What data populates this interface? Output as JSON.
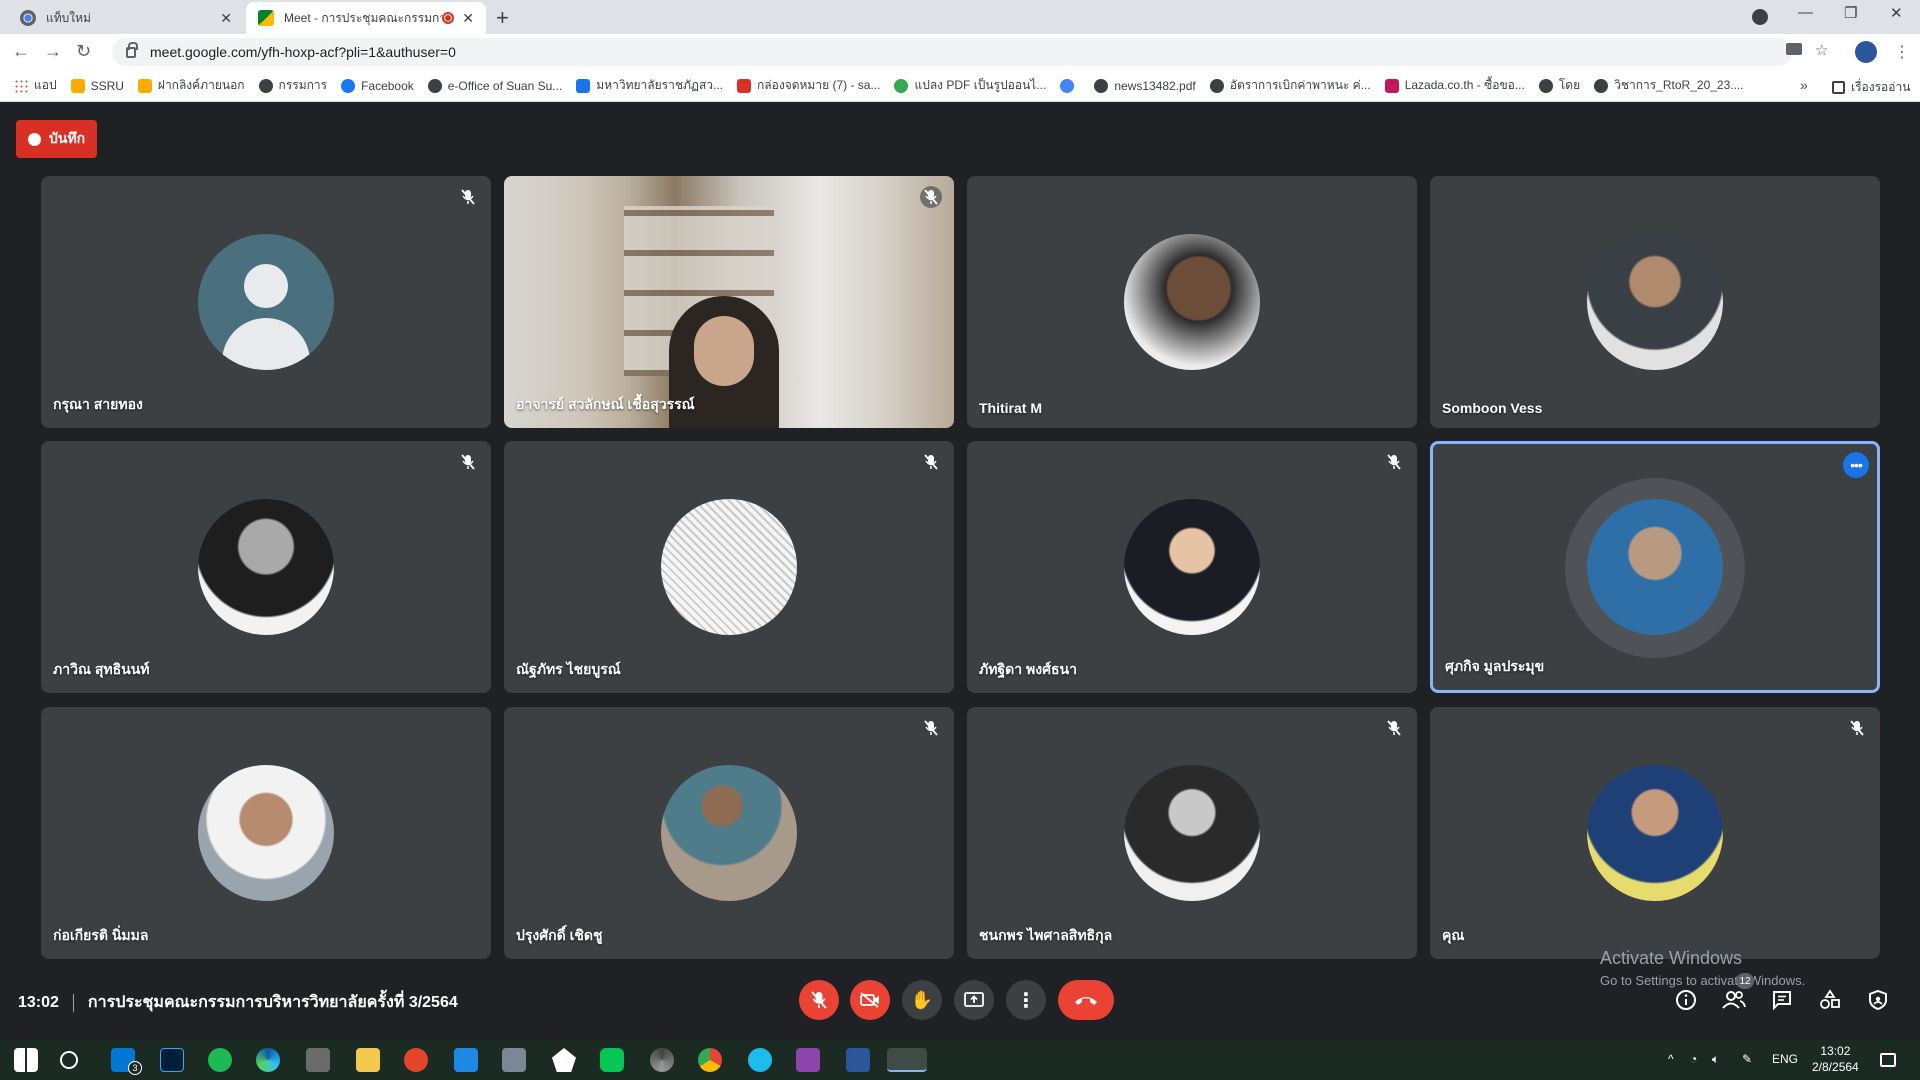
{
  "browser": {
    "tabs": [
      {
        "title": "แท็บใหม่",
        "active": false
      },
      {
        "title": "Meet - การประชุมคณะกรรมการ",
        "active": true,
        "recording": true
      }
    ],
    "new_tab_label": "+",
    "url": "meet.google.com/yfh-hoxp-acf?pli=1&authuser=0",
    "bookmarks": [
      {
        "label": "แอป",
        "color": "#ea4335"
      },
      {
        "label": "SSRU",
        "color": "#f9ab00"
      },
      {
        "label": "ฝากลิงค์ภายนอก",
        "color": "#f9ab00"
      },
      {
        "label": "กรรมการ",
        "color": "#3c4043"
      },
      {
        "label": "Facebook",
        "color": "#1877f2"
      },
      {
        "label": "e-Office of Suan Su...",
        "color": "#3c4043"
      },
      {
        "label": "มหาวิทยาลัยราชภัฏสว...",
        "color": "#1a73e8"
      },
      {
        "label": "กล่องจดหมาย (7) - sa...",
        "color": "#d93025"
      },
      {
        "label": "แปลง PDF เป็นรูปออนไ...",
        "color": "#34a853"
      },
      {
        "label": "",
        "color": "#4285f4"
      },
      {
        "label": "news13482.pdf",
        "color": "#3c4043"
      },
      {
        "label": "อัตราการเบิกค่าพาหนะ ค่...",
        "color": "#3c4043"
      },
      {
        "label": "Lazada.co.th - ซื้อขอ...",
        "color": "#c2185b"
      },
      {
        "label": "โดย",
        "color": "#3c4043"
      },
      {
        "label": "วิชาการ_RtoR_20_23....",
        "color": "#3c4043"
      }
    ],
    "more_bookmarks": "»",
    "reading_list": "เรื่องรออ่าน"
  },
  "meet": {
    "recording_label": "บันทึก",
    "participants": [
      {
        "name": "กรุณา สายทอง",
        "muted": true,
        "avatar": "default",
        "color": "#4a6f7d"
      },
      {
        "name": "อาจารย์ สวลักษณ์ เชื้อสุวรรณ์",
        "muted": true,
        "avatar": "video",
        "color": "#8c7a62"
      },
      {
        "name": "Thitirat M",
        "muted": false,
        "avatar": "photo",
        "color": "#2b2b2b"
      },
      {
        "name": "Somboon Vess",
        "muted": false,
        "avatar": "photo",
        "color": "#3a3f45"
      },
      {
        "name": "ภาวิณ สุทธินนท์",
        "muted": true,
        "avatar": "photo",
        "color": "#6e6e6e"
      },
      {
        "name": "ณัฐภัทร ไชยบูรณ์",
        "muted": true,
        "avatar": "photo",
        "color": "#d9d9d9"
      },
      {
        "name": "ภัทฐิดา พงศ์ธนา",
        "muted": true,
        "avatar": "photo",
        "color": "#1c1c24"
      },
      {
        "name": "ศุภกิจ มูลประมุข",
        "muted": false,
        "avatar": "photo",
        "speaking": true,
        "color": "#2f6fa8"
      },
      {
        "name": "ก่อเกียรติ นิ่มมล",
        "muted": false,
        "avatar": "photo",
        "color": "#9a7a68"
      },
      {
        "name": "ปรุงศักดิ์ เชิดชู",
        "muted": true,
        "avatar": "photo",
        "color": "#4e7c8a"
      },
      {
        "name": "ชนกพร ไพศาลสิทธิกุล",
        "muted": true,
        "avatar": "photo",
        "color": "#8a8a8a"
      },
      {
        "name": "คุณ",
        "muted": true,
        "avatar": "photo",
        "color": "#1f3f77"
      }
    ],
    "time": "13:02",
    "meeting_title": "การประชุมคณะกรรมการบริหารวิทยาลัยครั้งที่ 3/2564",
    "participant_count": "12",
    "activate_title": "Activate Windows",
    "activate_subtitle": "Go to Settings to activate Windows."
  },
  "taskbar": {
    "mail_badge": "3",
    "language": "ENG",
    "clock_time": "13:02",
    "clock_date": "2/8/2564"
  }
}
